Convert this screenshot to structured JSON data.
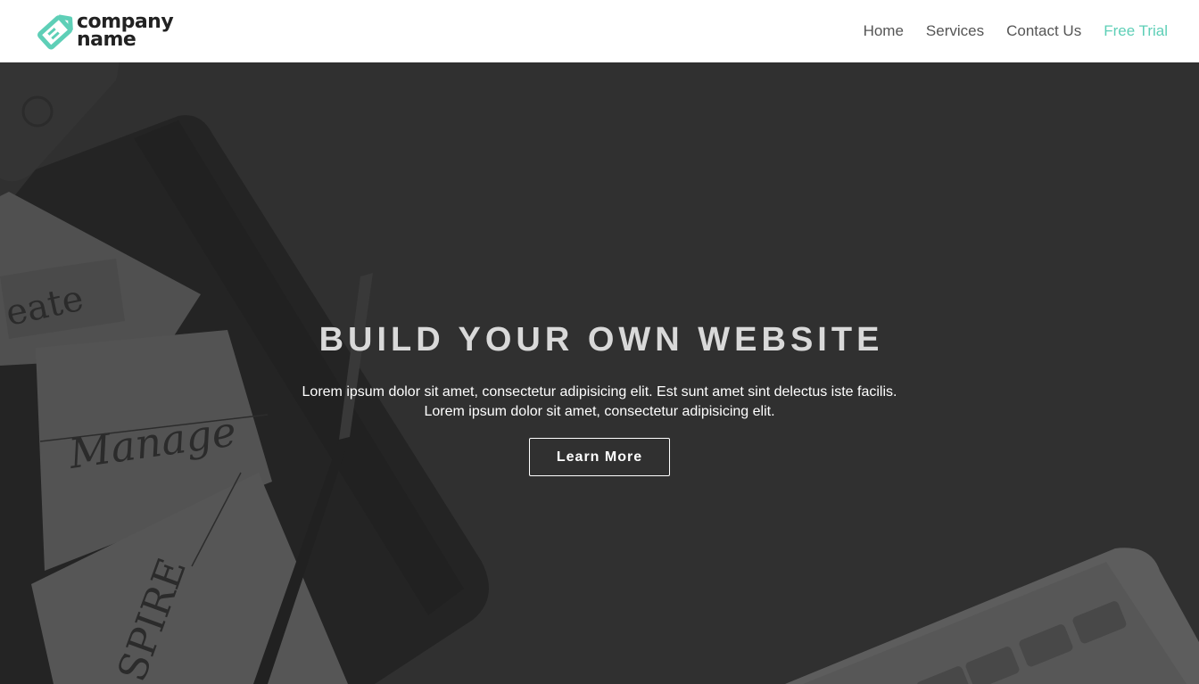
{
  "brand": {
    "line1": "company",
    "line2": "name",
    "accent_color": "#5ecfb7",
    "icon": "tag-logo-icon"
  },
  "nav": {
    "items": [
      {
        "label": "Home"
      },
      {
        "label": "Services"
      },
      {
        "label": "Contact Us"
      },
      {
        "label": "Free Trial"
      }
    ]
  },
  "hero": {
    "title": "BUILD YOUR OWN WEBSITE",
    "text_line1": "Lorem ipsum dolor sit amet, consectetur adipisicing elit. Est sunt amet sint delectus iste facilis.",
    "text_line2": "Lorem ipsum dolor sit amet, consectetur adipisicing elit.",
    "button_label": "Learn More"
  }
}
